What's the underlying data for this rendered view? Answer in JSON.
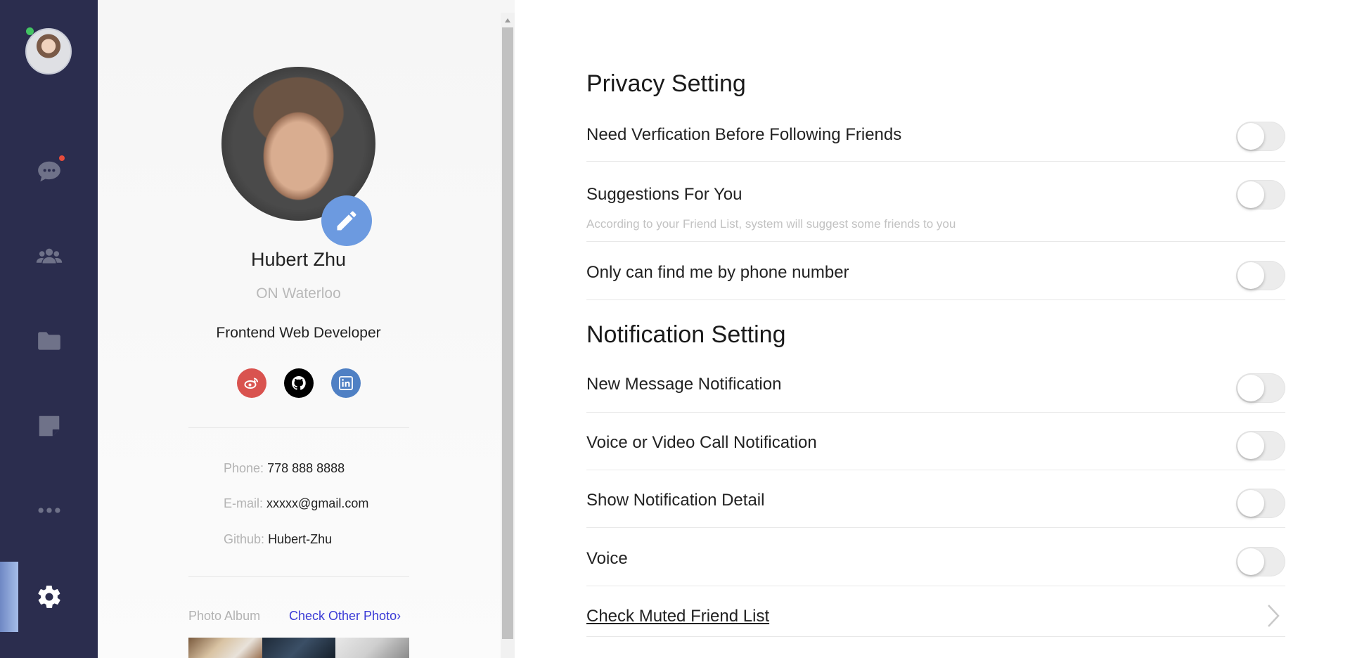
{
  "nav": {
    "items": [
      {
        "name": "chat",
        "icon": "chat-icon",
        "has_unread": true
      },
      {
        "name": "contacts",
        "icon": "group-icon"
      },
      {
        "name": "files",
        "icon": "folder-icon"
      },
      {
        "name": "notes",
        "icon": "note-icon"
      },
      {
        "name": "more",
        "icon": "more-icon"
      },
      {
        "name": "settings",
        "icon": "gear-icon",
        "active": true
      }
    ],
    "status": "online"
  },
  "profile": {
    "name": "Hubert Zhu",
    "location": "ON Waterloo",
    "role": "Frontend Web Developer",
    "social": [
      {
        "name": "weibo",
        "icon": "weibo-icon",
        "color": "#d9534f"
      },
      {
        "name": "github",
        "icon": "github-icon",
        "color": "#000000"
      },
      {
        "name": "linkedin",
        "icon": "linkedin-icon",
        "color": "#4f80c4"
      }
    ],
    "phone_label": "Phone:",
    "phone": "778 888 8888",
    "email_label": "E-mail:",
    "email": "xxxxx@gmail.com",
    "github_label": "Github:",
    "github": "Hubert-Zhu",
    "album_label": "Photo Album",
    "album_link": "Check Other Photo"
  },
  "privacy": {
    "title": "Privacy Setting",
    "items": [
      {
        "label": "Need Verfication Before Following Friends",
        "on": false
      },
      {
        "label": "Suggestions For You",
        "desc": "According to your Friend List, system will suggest some friends to you",
        "on": false
      },
      {
        "label": "Only can find me by phone number",
        "on": false
      }
    ]
  },
  "notification": {
    "title": "Notification Setting",
    "items": [
      {
        "label": "New Message Notification",
        "on": false
      },
      {
        "label": "Voice or Video Call Notification",
        "on": false
      },
      {
        "label": "Show Notification Detail",
        "on": false
      },
      {
        "label": "Voice",
        "on": false
      }
    ],
    "muted_link": "Check Muted Friend List"
  },
  "colors": {
    "rail": "#2b2d4e",
    "accent": "#6c9ae0",
    "link": "#2323d2"
  }
}
